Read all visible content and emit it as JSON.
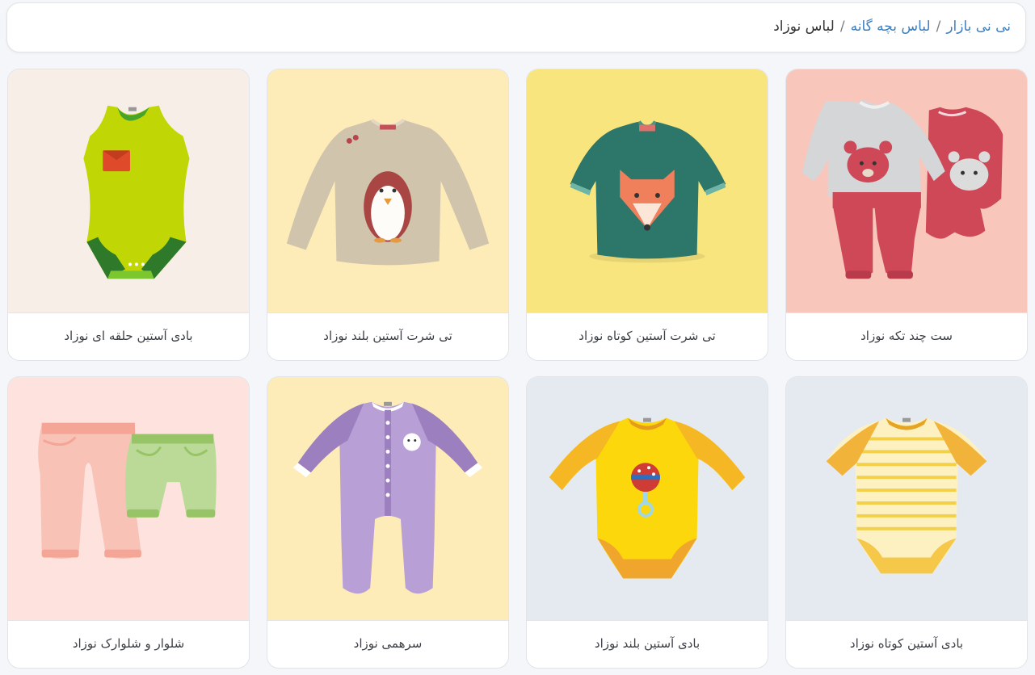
{
  "breadcrumb": {
    "items": [
      {
        "label": "نی نی بازار"
      },
      {
        "label": "لباس بچه گانه"
      }
    ],
    "separator": "/",
    "current": "لباس نوزاد"
  },
  "products": [
    {
      "title": "ست چند تکه نوزاد",
      "bg": "#f9c6bb",
      "icon": "baby-set-icon"
    },
    {
      "title": "تی شرت آستین کوتاه نوزاد",
      "bg": "#f9e57e",
      "icon": "fox-tshirt-icon"
    },
    {
      "title": "تی شرت آستین بلند نوزاد",
      "bg": "#fdebb8",
      "icon": "penguin-sweater-icon"
    },
    {
      "title": "بادی آستین حلقه ای نوزاد",
      "bg": "#f8eee8",
      "icon": "sleeveless-bodysuit-icon"
    },
    {
      "title": "بادی آستین کوتاه نوزاد",
      "bg": "#e5eaf0",
      "icon": "striped-bodysuit-icon"
    },
    {
      "title": "بادی آستین بلند نوزاد",
      "bg": "#e5eaf0",
      "icon": "yellow-bodysuit-icon"
    },
    {
      "title": "سرهمی نوزاد",
      "bg": "#fdebb8",
      "icon": "purple-romper-icon"
    },
    {
      "title": "شلوار و شلوارک نوزاد",
      "bg": "#fde2dd",
      "icon": "pants-shorts-icon"
    }
  ]
}
